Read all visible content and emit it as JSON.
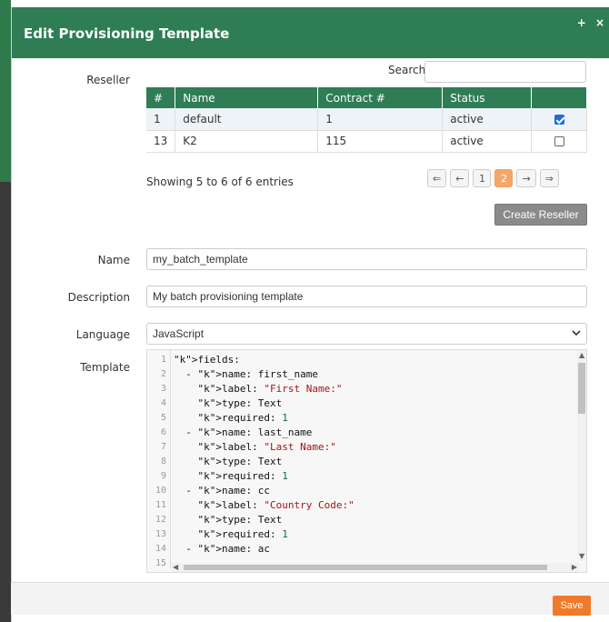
{
  "dialog": {
    "title": "Edit Provisioning Template",
    "controls": [
      "+",
      "×"
    ]
  },
  "reseller": {
    "label": "Reseller",
    "search_label": "Search:",
    "search_value": "",
    "columns": [
      "#",
      "Name",
      "Contract #",
      "Status",
      ""
    ],
    "rows": [
      {
        "id": "1",
        "name": "default",
        "contract": "1",
        "status": "active",
        "selected": true
      },
      {
        "id": "13",
        "name": "K2",
        "contract": "115",
        "status": "active",
        "selected": false
      }
    ],
    "showing": "Showing 5 to 6 of 6 entries",
    "pager": [
      "⇐",
      "←",
      "1",
      "2",
      "→",
      "⇒"
    ],
    "active_page": "2",
    "create_button": "Create Reseller"
  },
  "form": {
    "name_label": "Name",
    "name_value": "my_batch_template",
    "description_label": "Description",
    "description_value": "My batch provisioning template",
    "language_label": "Language",
    "language_value": "JavaScript",
    "template_label": "Template"
  },
  "editor": {
    "lines": [
      {
        "n": "1",
        "text": "fields:"
      },
      {
        "n": "2",
        "text": "  - name: first_name"
      },
      {
        "n": "3",
        "text": "    label: \"First Name:\""
      },
      {
        "n": "4",
        "text": "    type: Text"
      },
      {
        "n": "5",
        "text": "    required: 1"
      },
      {
        "n": "6",
        "text": "  - name: last_name"
      },
      {
        "n": "7",
        "text": "    label: \"Last Name:\""
      },
      {
        "n": "8",
        "text": "    type: Text"
      },
      {
        "n": "9",
        "text": "    required: 1"
      },
      {
        "n": "10",
        "text": "  - name: cc"
      },
      {
        "n": "11",
        "text": "    label: \"Country Code:\""
      },
      {
        "n": "12",
        "text": "    type: Text"
      },
      {
        "n": "13",
        "text": "    required: 1"
      },
      {
        "n": "14",
        "text": "  - name: ac"
      },
      {
        "n": "15",
        "text": ""
      }
    ]
  },
  "footer": {
    "save_button": "Save"
  },
  "colors": {
    "header": "#2e7d55",
    "save": "#f07a2a",
    "active_page": "#f5a76a"
  }
}
